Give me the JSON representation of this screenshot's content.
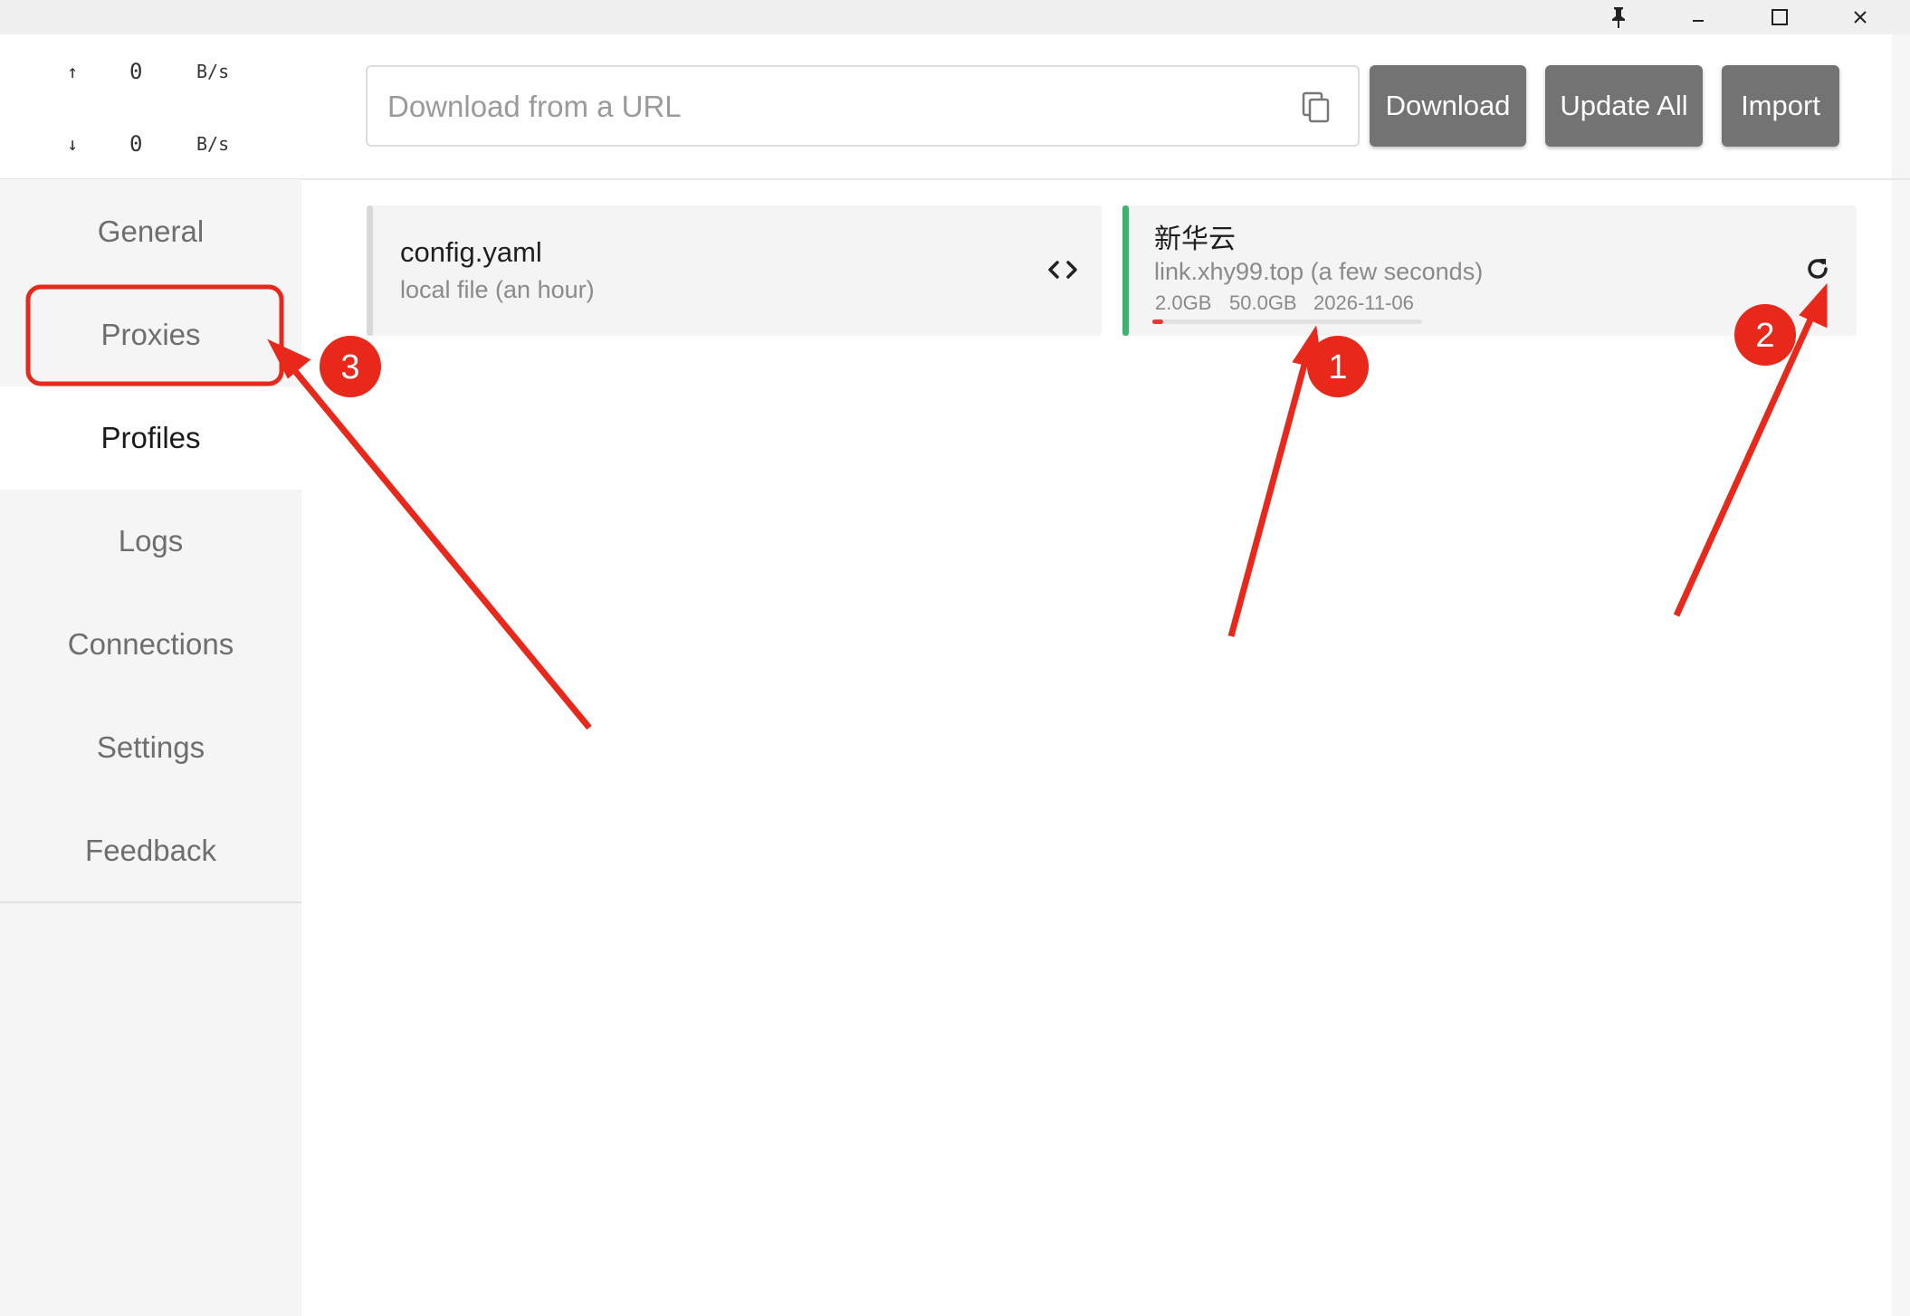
{
  "window": {
    "pin_icon": "pin-icon",
    "minimize_icon": "minimize-icon",
    "maximize_icon": "maximize-icon",
    "close_icon": "close-icon"
  },
  "traffic": {
    "upload": {
      "arrow": "↑",
      "value": "0",
      "unit": "B/s"
    },
    "download": {
      "arrow": "↓",
      "value": "0",
      "unit": "B/s"
    }
  },
  "sidebar": {
    "items": [
      {
        "label": "General",
        "active": false
      },
      {
        "label": "Proxies",
        "active": false
      },
      {
        "label": "Profiles",
        "active": true
      },
      {
        "label": "Logs",
        "active": false
      },
      {
        "label": "Connections",
        "active": false
      },
      {
        "label": "Settings",
        "active": false
      },
      {
        "label": "Feedback",
        "active": false
      }
    ]
  },
  "toolbar": {
    "url_placeholder": "Download from a URL",
    "url_value": "",
    "download_label": "Download",
    "update_all_label": "Update All",
    "import_label": "Import"
  },
  "profiles": [
    {
      "name": "config.yaml",
      "subtitle": "local file (an hour)",
      "selected": false,
      "action_icon": "code-icon"
    },
    {
      "name": "新华云",
      "subtitle": "link.xhy99.top (a few seconds)",
      "used": "2.0GB",
      "total": "50.0GB",
      "expire": "2026-11-06",
      "usage_fraction": 0.04,
      "selected": true,
      "action_icon": "refresh-icon"
    }
  ],
  "annotations": {
    "marker_1": "1",
    "marker_2": "2",
    "marker_3": "3"
  },
  "colors": {
    "selected_bar": "#3cb371",
    "unselected_bar": "#d9d9d9",
    "button_bg": "#737373",
    "annotation_red": "#e8281a",
    "usage_fill": "#e53935"
  }
}
